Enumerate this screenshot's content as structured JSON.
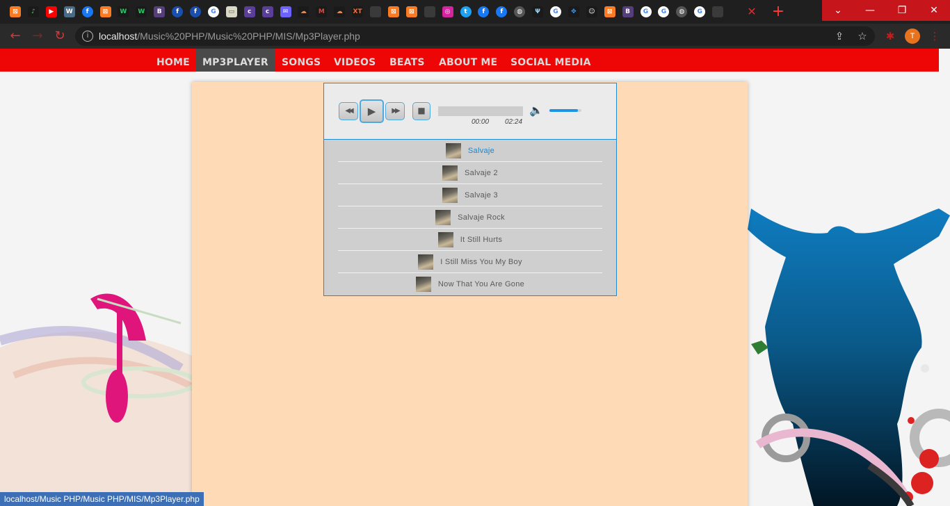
{
  "browser": {
    "tab_favicons": [
      {
        "icon": "xampp-icon",
        "label": "⊠",
        "bg": "#fb7a24"
      },
      {
        "icon": "music-note-icon",
        "label": "♪",
        "bg": "#1a1a1a",
        "fg": "#3fd06a"
      },
      {
        "icon": "youtube-icon",
        "label": "▶",
        "bg": "#ff0000"
      },
      {
        "icon": "wordpress-icon",
        "label": "W",
        "bg": "#4a6b85"
      },
      {
        "icon": "facebook-icon",
        "label": "f",
        "bg": "#1877f2"
      },
      {
        "icon": "xampp-icon",
        "label": "⊠",
        "bg": "#fb7a24"
      },
      {
        "icon": "w-icon",
        "label": "W",
        "bg": "#1a1a1a",
        "fg": "#35c46a"
      },
      {
        "icon": "w-icon",
        "label": "W",
        "bg": "#1a1a1a",
        "fg": "#35c46a"
      },
      {
        "icon": "bootstrap-icon",
        "label": "B",
        "bg": "#563d7c"
      },
      {
        "icon": "facebook-lite-icon",
        "label": "f",
        "bg": "#1a4fb0"
      },
      {
        "icon": "facebook-lite-icon",
        "label": "f",
        "bg": "#1a4fb0"
      },
      {
        "icon": "google-icon",
        "label": "G",
        "bg": "#ffffff",
        "fg": "#4285f4"
      },
      {
        "icon": "image-icon",
        "label": "▭",
        "bg": "#d9d9c5",
        "fg": "#555"
      },
      {
        "icon": "colorlib-icon",
        "label": "c",
        "bg": "#5b3e9a"
      },
      {
        "icon": "colorlib-icon",
        "label": "c",
        "bg": "#5b3e9a"
      },
      {
        "icon": "mail-icon",
        "label": "✉",
        "bg": "#6b63ff"
      },
      {
        "icon": "cloud-icon",
        "label": "☁",
        "bg": "#1a1a1a",
        "fg": "#e08a5a"
      },
      {
        "icon": "gmail-icon",
        "label": "M",
        "bg": "#1a1a1a",
        "fg": "#ea4335"
      },
      {
        "icon": "cloud-icon",
        "label": "☁",
        "bg": "#1a1a1a",
        "fg": "#e08a5a"
      },
      {
        "icon": "xt-icon",
        "label": "XT",
        "bg": "#1a1a1a",
        "fg": "#ff6a2b"
      },
      {
        "icon": "blank-tab-icon",
        "label": "",
        "bg": "#3a3a3a"
      },
      {
        "icon": "xampp-icon",
        "label": "⊠",
        "bg": "#fb7a24"
      },
      {
        "icon": "xampp-icon",
        "label": "⊠",
        "bg": "#fb7a24"
      },
      {
        "icon": "blank-tab-icon",
        "label": "",
        "bg": "#3a3a3a"
      },
      {
        "icon": "instagram-icon",
        "label": "◎",
        "bg": "#d6249f"
      },
      {
        "icon": "twitter-icon",
        "label": "t",
        "bg": "#1da1f2"
      },
      {
        "icon": "facebook-icon",
        "label": "f",
        "bg": "#1877f2"
      },
      {
        "icon": "facebook-icon",
        "label": "f",
        "bg": "#1877f2"
      },
      {
        "icon": "globe-icon",
        "label": "◍",
        "bg": "#555"
      },
      {
        "icon": "trident-icon",
        "label": "Ψ",
        "bg": "#1a1a1a",
        "fg": "#9bd1f2"
      },
      {
        "icon": "google-icon",
        "label": "G",
        "bg": "#ffffff",
        "fg": "#4285f4"
      },
      {
        "icon": "dots-icon",
        "label": "✥",
        "bg": "#1a1a1a",
        "fg": "#39a0ff"
      },
      {
        "icon": "snapchat-icon",
        "label": "☺",
        "bg": "#1a1a1a",
        "fg": "#ffffff"
      },
      {
        "icon": "xampp-icon",
        "label": "⊠",
        "bg": "#fb7a24"
      },
      {
        "icon": "bootstrap-icon",
        "label": "B",
        "bg": "#563d7c"
      },
      {
        "icon": "google-icon",
        "label": "G",
        "bg": "#ffffff",
        "fg": "#4285f4"
      },
      {
        "icon": "google-icon",
        "label": "G",
        "bg": "#ffffff",
        "fg": "#4285f4"
      },
      {
        "icon": "globe-icon",
        "label": "◍",
        "bg": "#555"
      },
      {
        "icon": "google-icon",
        "label": "G",
        "bg": "#ffffff",
        "fg": "#4285f4"
      },
      {
        "icon": "blank-tab-icon",
        "label": "",
        "bg": "#3a3a3a"
      }
    ],
    "tab_close_glyph": "✕",
    "new_tab_glyph": "+",
    "window_buttons": {
      "dropdown": "⌄",
      "minimize": "—",
      "restore": "❐",
      "close": "✕"
    },
    "nav_glyphs": {
      "back": "←",
      "forward": "→",
      "reload": "↻"
    },
    "url_host": "localhost",
    "url_path": "/Music%20PHP/Music%20PHP/MIS/Mp3Player.php",
    "toolbar_glyphs": {
      "share": "⇪",
      "star": "☆",
      "extension": "✱",
      "menu": "⋮"
    },
    "profile_initial": "T",
    "status_url": "localhost/Music PHP/Music PHP/MIS/Mp3Player.php"
  },
  "site": {
    "nav": [
      "HOME",
      "MP3PLAYER",
      "SONGS",
      "VIDEOS",
      "BEATS",
      "ABOUT ME",
      "SOCIAL MEDIA"
    ],
    "active_nav": "MP3PLAYER",
    "colors": {
      "nav_bg": "#ee0505",
      "content_bg": "#fedab6",
      "player_border": "#1f8ad2",
      "accent": "#1d94e4"
    }
  },
  "player": {
    "buttons": {
      "rewind": "◀◀",
      "play": "▶",
      "forward": "▶▶",
      "stop": "■"
    },
    "volume_glyph": "🔈",
    "current_time": "00:00",
    "duration": "02:24",
    "progress": 0,
    "volume": 0.9,
    "playlist": [
      {
        "title": "Salvaje",
        "current": true
      },
      {
        "title": "Salvaje 2",
        "current": false
      },
      {
        "title": "Salvaje 3",
        "current": false
      },
      {
        "title": "Salvaje Rock",
        "current": false
      },
      {
        "title": "It Still Hurts",
        "current": false
      },
      {
        "title": "I Still Miss You My Boy",
        "current": false
      },
      {
        "title": "Now That You Are Gone",
        "current": false
      }
    ]
  }
}
